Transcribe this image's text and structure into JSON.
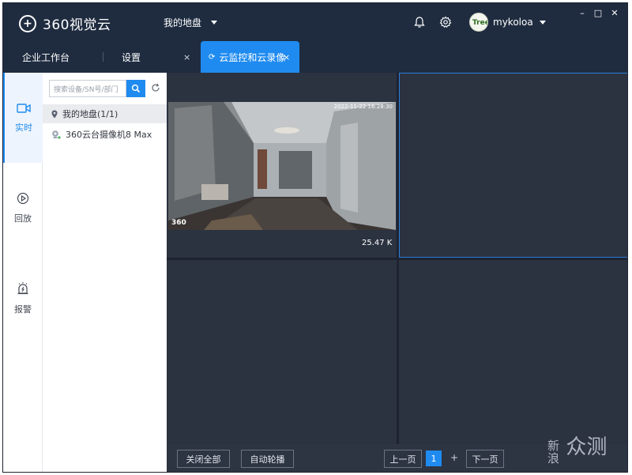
{
  "app": {
    "logo_text": "360视觉云",
    "drive_label": "我的地盘",
    "user_name": "mykoloa",
    "avatar_text": "Tree"
  },
  "window_controls": {
    "minimize": "–",
    "maximize": "□",
    "close": "✕"
  },
  "tabs": [
    {
      "label": "企业工作台"
    },
    {
      "label": "设置"
    },
    {
      "label": "云监控和云录像",
      "active": true
    }
  ],
  "leftnav": {
    "items": [
      {
        "label": "实时",
        "icon": "camera-icon",
        "active": true
      },
      {
        "label": "回放",
        "icon": "play-icon"
      },
      {
        "label": "报警",
        "icon": "alarm-icon"
      }
    ]
  },
  "tree": {
    "search_placeholder": "搜索设备/SN号/部门",
    "nodes": [
      {
        "label": "我的地盘(1/1)",
        "icon": "location-pin-icon",
        "selected": true
      },
      {
        "label": "360云台摄像机8 Max",
        "icon": "camera-device-icon"
      }
    ]
  },
  "video": {
    "timestamp": "2022-11-22 16:28:30",
    "brand_overlay": "360",
    "bitrate": "25.47 K"
  },
  "bottombar": {
    "close_all": "关闭全部",
    "auto_rotate": "自动轮播",
    "prev_page": "上一页",
    "current_page": "1",
    "add_page": "+",
    "next_page": "下一页",
    "watermark_top": "新",
    "watermark_bottom": "浪",
    "watermark_big": "众测"
  },
  "colors": {
    "titlebar": "#1f2c40",
    "accent": "#1f8bf0",
    "grid_bg": "#2b3240"
  }
}
